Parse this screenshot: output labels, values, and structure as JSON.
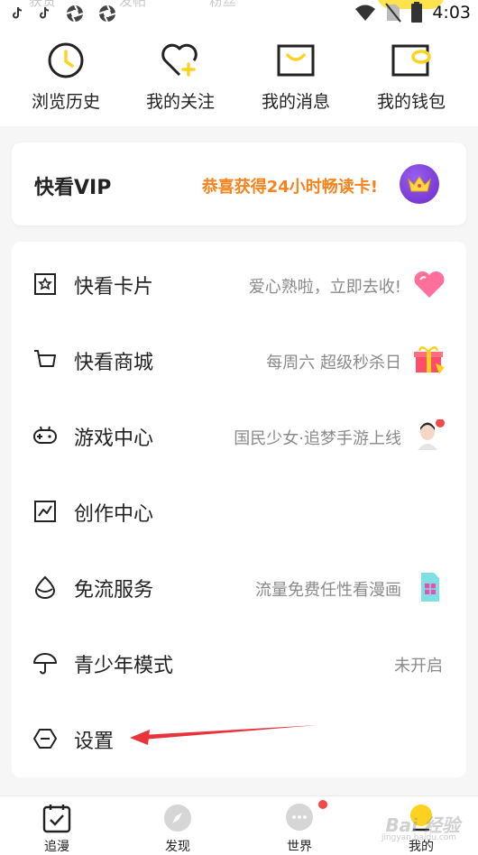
{
  "status_bar": {
    "time": "4:03",
    "ghost_tabs": [
      "获赞",
      "发帖",
      "粉丝"
    ]
  },
  "quick_actions": [
    {
      "label": "浏览历史",
      "icon": "clock-icon"
    },
    {
      "label": "我的关注",
      "icon": "heart-plus-icon"
    },
    {
      "label": "我的消息",
      "icon": "envelope-icon"
    },
    {
      "label": "我的钱包",
      "icon": "wallet-icon"
    }
  ],
  "vip": {
    "title": "快看VIP",
    "promo": "恭喜获得24小时畅读卡!",
    "badge_icon": "crown-icon",
    "accent": "#f5841f"
  },
  "menu": [
    {
      "label": "快看卡片",
      "hint": "爱心熟啦，立即去收!",
      "icon": "card-icon",
      "deco": "pink-heart"
    },
    {
      "label": "快看商城",
      "hint": "每周六 超级秒杀日",
      "icon": "cart-icon",
      "deco": "gift-box"
    },
    {
      "label": "游戏中心",
      "hint": "国民少女·追梦手游上线",
      "icon": "gamepad-icon",
      "deco": "game-avatar"
    },
    {
      "label": "创作中心",
      "hint": "",
      "icon": "chart-frame-icon",
      "deco": ""
    },
    {
      "label": "免流服务",
      "hint": "流量免费任性看漫画",
      "icon": "drop-icon",
      "deco": "sim-card"
    },
    {
      "label": "青少年模式",
      "hint": "未开启",
      "icon": "umbrella-icon",
      "deco": ""
    },
    {
      "label": "设置",
      "hint": "",
      "icon": "hexagon-icon",
      "deco": ""
    }
  ],
  "bottom_nav": [
    {
      "label": "追漫",
      "icon": "calendar-check-icon"
    },
    {
      "label": "发现",
      "icon": "compass-icon"
    },
    {
      "label": "世界",
      "icon": "chat-bubble-icon"
    },
    {
      "label": "我的",
      "icon": "profile-icon"
    }
  ],
  "watermark": {
    "text": "Bai 经验",
    "sub": "jingyan.baidu.com"
  },
  "colors": {
    "brand_yellow": "#ffe34d",
    "notify_red": "#f24a4a",
    "arrow_red": "#e8333a"
  }
}
